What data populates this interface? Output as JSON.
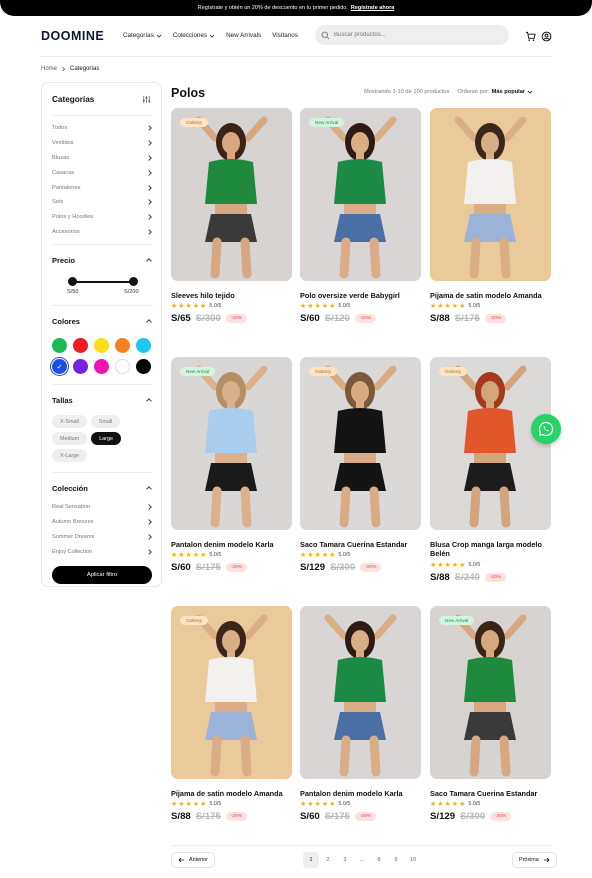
{
  "announcement": {
    "text": "Regístrate y obtén un 20% de descuento en tu primer pedido.",
    "cta": "Regístrate ahora"
  },
  "header": {
    "logo": "DOOMINE",
    "nav": [
      "Categorías",
      "Colecciones",
      "New Arrivals",
      "Visítanos"
    ],
    "search_placeholder": "Buscar productos..."
  },
  "breadcrumb": {
    "home": "Home",
    "current": "Categorías"
  },
  "sidebar": {
    "title": "Categorías",
    "categories": [
      "Todos",
      "Vestidos",
      "Blusas",
      "Casacas",
      "Pantalones",
      "Sets",
      "Polos y Hoodies",
      "Accesorios"
    ],
    "price": {
      "title": "Precio",
      "min": "S/50",
      "max": "S/200",
      "min_value": 50,
      "max_value": 200
    },
    "colors": {
      "title": "Colores",
      "swatches": [
        "#1db954",
        "#ee1c25",
        "#f7e01a",
        "#f58220",
        "#1ec6f0",
        "#1f4fe0",
        "#7b22e0",
        "#f013b0",
        "#ffffff",
        "#000000"
      ],
      "selected": 5
    },
    "sizes": {
      "title": "Tallas",
      "items": [
        "X-Small",
        "Small",
        "Medium",
        "Large",
        "X-Large"
      ],
      "selected": "Large"
    },
    "collection": {
      "title": "Colección",
      "items": [
        "Real Sensation",
        "Autumn Breezes",
        "Summer Dreams",
        "Enjoy Collection"
      ]
    },
    "apply_label": "Aplicar filtro"
  },
  "main": {
    "title": "Polos",
    "results": "Mostrando 1-10 de 100 productos",
    "sort_label": "Ordenar por:",
    "sort_value": "Más popular"
  },
  "products": [
    {
      "name": "Sleeves hilo tejido",
      "rating": "5.0/5",
      "price": "S/65",
      "old_price": "S/300",
      "discount": "-20%",
      "badge": "Outlet",
      "badge_type": "outlet",
      "bg": "#d6d3d1",
      "top": "#1f8a3c",
      "bottom": "#3a3a3a",
      "skin": "#d7a77f",
      "hair": "#3a2418"
    },
    {
      "name": "Polo oversize verde Babygirl",
      "rating": "5.0/5",
      "price": "S/60",
      "old_price": "S/120",
      "discount": "-20%",
      "badge": "New Arrival",
      "badge_type": "new",
      "bg": "#d8d5d4",
      "top": "#1b8a45",
      "bottom": "#4a6fa5",
      "skin": "#d9ad85",
      "hair": "#2d1a12"
    },
    {
      "name": "Pijama de satin modelo Amanda",
      "rating": "5.0/5",
      "price": "S/88",
      "old_price": "S/175",
      "discount": "-20%",
      "badge": "",
      "badge_type": "",
      "bg": "#eac99a",
      "top": "#f3f1f0",
      "bottom": "#9bb3d9",
      "skin": "#d9ae86",
      "hair": "#3b2719"
    },
    {
      "name": "Pantalon denim modelo Karla",
      "rating": "5.0/5",
      "price": "S/60",
      "old_price": "S/175",
      "discount": "-20%",
      "badge": "New Arrival",
      "badge_type": "new",
      "bg": "#d9d7d6",
      "top": "#a8cdee",
      "bottom": "#1a1a1a",
      "skin": "#dcb08a",
      "hair": "#b58f64"
    },
    {
      "name": "Saco Tamara Cuerina Estandar",
      "rating": "5.0/5",
      "price": "S/129",
      "old_price": "S/300",
      "discount": "-20%",
      "badge": "Outlet",
      "badge_type": "outlet",
      "bg": "#dbd9d8",
      "top": "#141414",
      "bottom": "#141414",
      "skin": "#d8ab83",
      "hair": "#7a5a3a"
    },
    {
      "name": "Blusa Crop manga larga modelo Belén",
      "rating": "5.0/5",
      "price": "S/88",
      "old_price": "S/240",
      "discount": "-20%",
      "badge": "Outlet",
      "badge_type": "outlet",
      "bg": "#dcdad9",
      "top": "#e2562b",
      "bottom": "#1c1c1c",
      "skin": "#d4a47a",
      "hair": "#a33a1f"
    },
    {
      "name": "Pijama de satin modelo Amanda",
      "rating": "5.0/5",
      "price": "S/88",
      "old_price": "S/175",
      "discount": "-20%",
      "badge": "Outlet",
      "badge_type": "outlet",
      "bg": "#eac99a",
      "top": "#f3f1f0",
      "bottom": "#9bb3d9",
      "skin": "#d9ae86",
      "hair": "#3b2719"
    },
    {
      "name": "Pantalon denim modelo Karla",
      "rating": "5.0/5",
      "price": "S/60",
      "old_price": "S/175",
      "discount": "-20%",
      "badge": "",
      "badge_type": "",
      "bg": "#d8d5d4",
      "top": "#1b8a45",
      "bottom": "#4a6fa5",
      "skin": "#d9ad85",
      "hair": "#2d1a12"
    },
    {
      "name": "Saco Tamara Cuerina Estandar",
      "rating": "5.0/5",
      "price": "S/129",
      "old_price": "S/300",
      "discount": "-20%",
      "badge": "New Arrival",
      "badge_type": "new",
      "bg": "#d6d3d1",
      "top": "#1f8a3c",
      "bottom": "#3a3a3a",
      "skin": "#d7a77f",
      "hair": "#3a2418"
    }
  ],
  "pagination": {
    "prev": "Anterior",
    "next": "Próxima",
    "pages": [
      "1",
      "2",
      "3",
      "...",
      "8",
      "9",
      "10"
    ],
    "current": "1"
  }
}
